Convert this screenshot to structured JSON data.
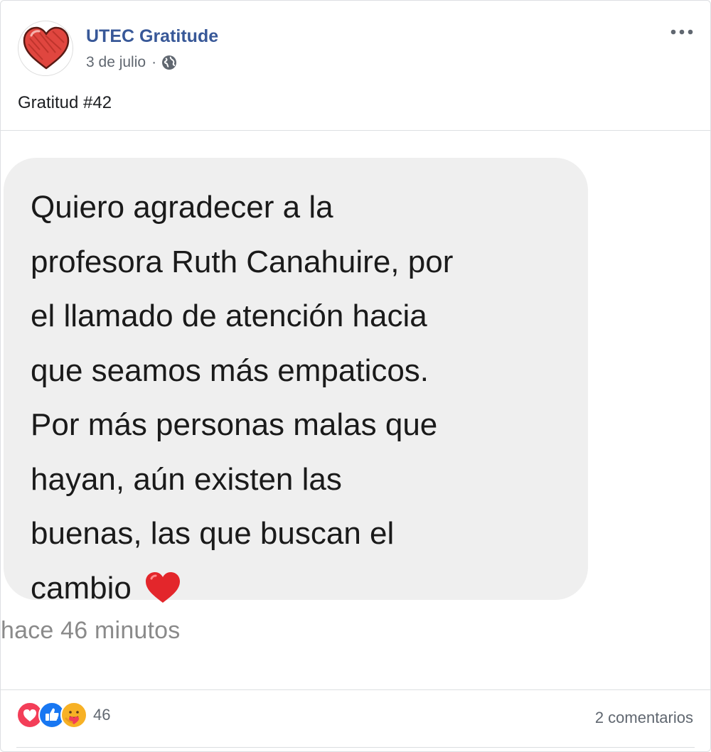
{
  "post": {
    "page_name": "UTEC Gratitude",
    "date": "3 de julio",
    "separator": "·",
    "privacy_icon": "globe-icon",
    "more_icon": "more-options-icon",
    "avatar_icon": "heart-icon",
    "text": "Gratitud #42"
  },
  "image": {
    "message_text": "Quiero agradecer a la\nprofesora Ruth Canahuire, por\nel llamado de atención hacia\nque seamos más empaticos.\nPor más personas malas que\nhayan, aún existen las\nbuenas, las que buscan el\ncambio",
    "message_emoji": "red-heart-icon",
    "timestamp": "hace 46 minutos"
  },
  "footer": {
    "reaction_icons": [
      "love-reaction-icon",
      "like-reaction-icon",
      "care-reaction-icon"
    ],
    "reaction_count": "46",
    "comments": "2 comentarios"
  },
  "colors": {
    "page_name": "#385898",
    "meta_text": "#606770",
    "bubble_bg": "#efefef",
    "love": "#f33e58",
    "like": "#1877f2",
    "care": "#f7b125"
  }
}
